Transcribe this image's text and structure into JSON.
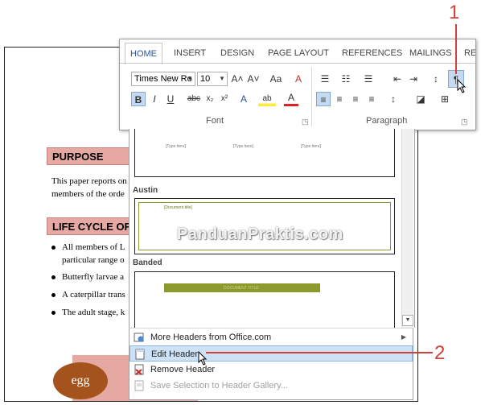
{
  "document": {
    "heading_purpose": "PURPOSE",
    "para_line1": "This paper reports on",
    "para_line2": "members of the orde",
    "heading_lifecycle": "LIFE CYCLE OF",
    "bullets": [
      {
        "line1": "All members of L",
        "line2": "particular range o"
      },
      {
        "line1": "Butterfly larvae a",
        "line2": ""
      },
      {
        "line1": "A caterpillar trans",
        "line2": ""
      },
      {
        "line1": "The adult stage, k",
        "line2": ""
      }
    ],
    "egg_label": "egg",
    "colors": {
      "heading_bg": "#e6a8a3",
      "egg": "#a4531c"
    }
  },
  "ribbon": {
    "tabs": [
      "HOME",
      "INSERT",
      "DESIGN",
      "PAGE LAYOUT",
      "REFERENCES",
      "MAILINGS",
      "RE"
    ],
    "active_tab": "HOME",
    "font_name": "Times New Ro",
    "font_size": "10",
    "group_font": "Font",
    "group_paragraph": "Paragraph",
    "buttons": {
      "grow": "A˄",
      "shrink": "A˅",
      "case": "Aa",
      "clear": "A",
      "bold": "B",
      "italic": "I",
      "underline": "U",
      "strike": "abc",
      "subscript": "x₂",
      "superscript": "x²",
      "effects": "A",
      "highlight": "ab",
      "fontcolor": "A",
      "show_marks": "¶"
    },
    "accent_color": "#2a5699"
  },
  "gallery": {
    "placeholder": "[Type here]",
    "doc_title_ph": "[Document title]",
    "section_austin": "Austin",
    "section_banded": "Banded",
    "banded_ph": "DOCUMENT TITLE",
    "banded_color": "#8a9a2c",
    "austin_color": "#8a9a2c"
  },
  "menu": {
    "items": [
      {
        "label": "More Headers from Office.com",
        "icon": "office-globe-icon",
        "has_submenu": true
      },
      {
        "label": "Edit Header",
        "icon": "edit-header-icon"
      },
      {
        "label": "Remove Header",
        "icon": "remove-header-icon"
      },
      {
        "label": "Save Selection to Header Gallery...",
        "icon": "save-selection-icon",
        "disabled": true
      }
    ]
  },
  "watermark": "PanduanPraktis.com",
  "callouts": {
    "one": "1",
    "two": "2",
    "color": "#d0413a"
  }
}
